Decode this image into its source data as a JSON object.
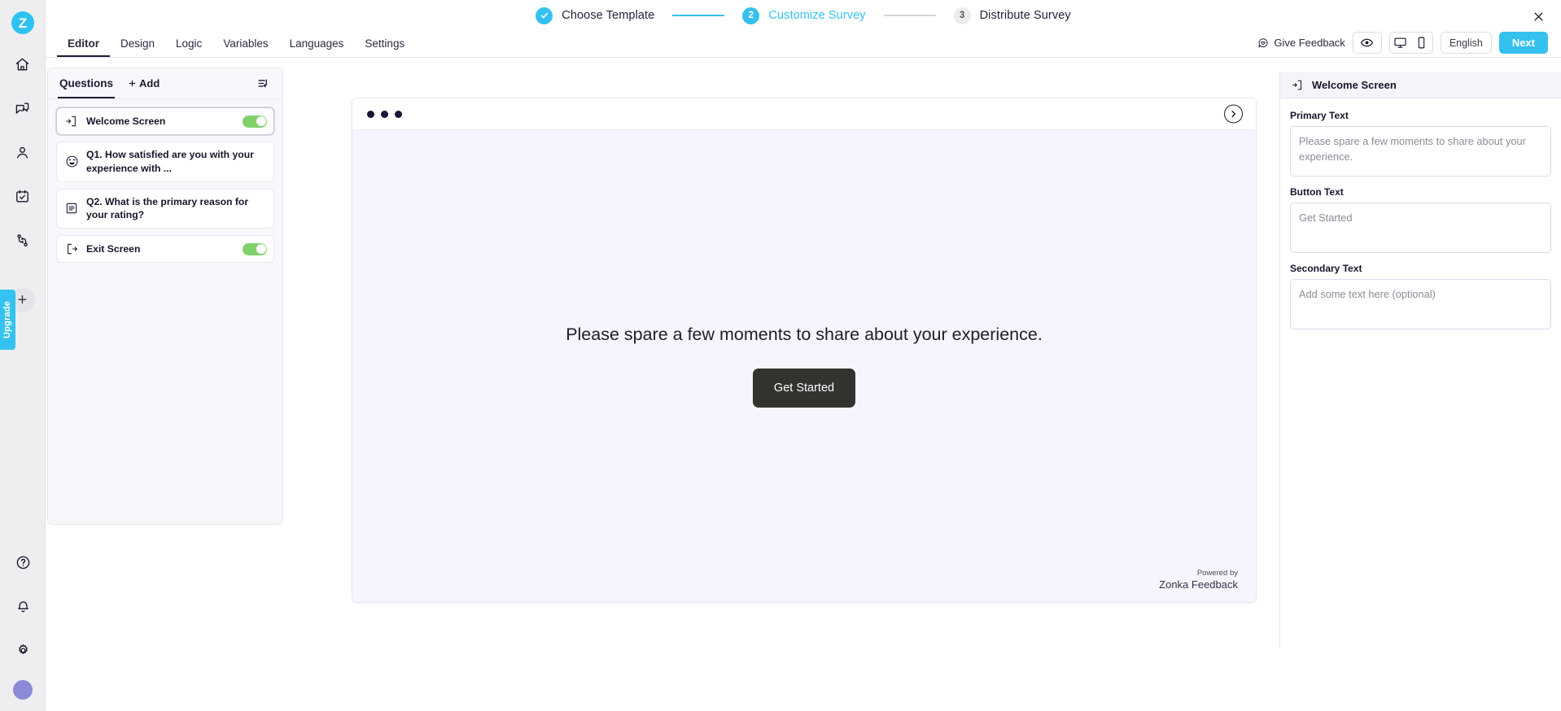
{
  "brand": {
    "logo_letter": "Z",
    "accent": "#35c1ee",
    "upgrade_label": "Upgrade"
  },
  "rail": {
    "items": [
      {
        "name": "home-icon",
        "label": "Home"
      },
      {
        "name": "feedback-icon",
        "label": "Feedback"
      },
      {
        "name": "contacts-icon",
        "label": "Contacts"
      },
      {
        "name": "tasks-icon",
        "label": "Tasks"
      },
      {
        "name": "workflows-icon",
        "label": "Workflows"
      }
    ],
    "add_label": "+",
    "bottom": [
      {
        "name": "help-icon",
        "label": "Help"
      },
      {
        "name": "notifications-icon",
        "label": "Notifications"
      },
      {
        "name": "settings-icon",
        "label": "Settings"
      }
    ]
  },
  "stepper": {
    "steps": [
      {
        "badge": "✓",
        "label": "Choose Template",
        "state": "done"
      },
      {
        "badge": "2",
        "label": "Customize Survey",
        "state": "active"
      },
      {
        "badge": "3",
        "label": "Distribute Survey",
        "state": "todo"
      }
    ],
    "close_label": "✕"
  },
  "tabbar": {
    "tabs": [
      {
        "label": "Editor",
        "active": true
      },
      {
        "label": "Design",
        "active": false
      },
      {
        "label": "Logic",
        "active": false
      },
      {
        "label": "Variables",
        "active": false
      },
      {
        "label": "Languages",
        "active": false
      },
      {
        "label": "Settings",
        "active": false
      }
    ],
    "feedback_label": "Give Feedback",
    "preview_icon": "eye-icon",
    "desktop_icon": "desktop-icon",
    "mobile_icon": "mobile-icon",
    "language": "English",
    "next_label": "Next"
  },
  "questions_panel": {
    "tab_label": "Questions",
    "add_label": "Add",
    "reorder_icon": "reorder-icon",
    "rows": [
      {
        "icon": "welcome-screen-icon",
        "label": "Welcome Screen",
        "toggle": true,
        "selected": true
      },
      {
        "icon": "smiley-rating-icon",
        "label": "Q1. How satisfied are you with your experience with ...",
        "toggle": false,
        "selected": false
      },
      {
        "icon": "text-question-icon",
        "label": "Q2. What is the primary reason for your rating?",
        "toggle": false,
        "selected": false
      },
      {
        "icon": "exit-screen-icon",
        "label": "Exit Screen",
        "toggle": true,
        "selected": false
      }
    ]
  },
  "preview": {
    "dots_count": 3,
    "next_icon": "chevron-right-icon",
    "primary_text": "Please spare a few moments to share about your experience.",
    "button_label": "Get Started",
    "powered_by_line1": "Powered by",
    "powered_by_line2": "Zonka Feedback"
  },
  "properties": {
    "title": "Welcome Screen",
    "title_icon": "welcome-screen-icon",
    "fields": [
      {
        "label": "Primary Text",
        "value": "",
        "placeholder": "Please spare a few moments to share about your experience."
      },
      {
        "label": "Button Text",
        "value": "",
        "placeholder": "Get Started"
      },
      {
        "label": "Secondary Text",
        "value": "",
        "placeholder": "Add some text here (optional)"
      }
    ]
  }
}
